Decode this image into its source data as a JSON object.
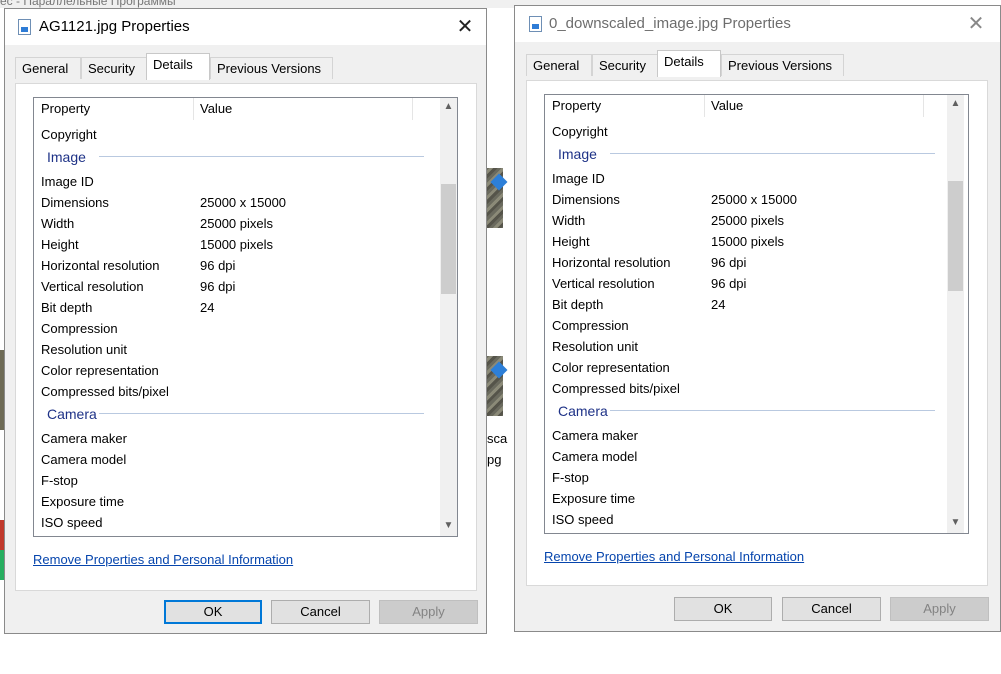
{
  "background": {
    "window_title_fragment": "ес - Параллельные Программы",
    "file_label_1": "sca",
    "file_label_2": "pg"
  },
  "dialogs": [
    {
      "title": "AG1121.jpg Properties",
      "tabs": [
        "General",
        "Security",
        "Details",
        "Previous Versions"
      ],
      "active_tab": "Details",
      "columns": {
        "property": "Property",
        "value": "Value"
      },
      "rows": [
        {
          "type": "prop",
          "p": "Copyright",
          "v": ""
        },
        {
          "type": "group",
          "p": "Image"
        },
        {
          "type": "prop",
          "p": "Image ID",
          "v": ""
        },
        {
          "type": "prop",
          "p": "Dimensions",
          "v": "25000 x 15000"
        },
        {
          "type": "prop",
          "p": "Width",
          "v": "25000 pixels"
        },
        {
          "type": "prop",
          "p": "Height",
          "v": "15000 pixels"
        },
        {
          "type": "prop",
          "p": "Horizontal resolution",
          "v": "96 dpi"
        },
        {
          "type": "prop",
          "p": "Vertical resolution",
          "v": "96 dpi"
        },
        {
          "type": "prop",
          "p": "Bit depth",
          "v": "24"
        },
        {
          "type": "prop",
          "p": "Compression",
          "v": ""
        },
        {
          "type": "prop",
          "p": "Resolution unit",
          "v": ""
        },
        {
          "type": "prop",
          "p": "Color representation",
          "v": ""
        },
        {
          "type": "prop",
          "p": "Compressed bits/pixel",
          "v": ""
        },
        {
          "type": "group",
          "p": "Camera"
        },
        {
          "type": "prop",
          "p": "Camera maker",
          "v": ""
        },
        {
          "type": "prop",
          "p": "Camera model",
          "v": ""
        },
        {
          "type": "prop",
          "p": "F-stop",
          "v": ""
        },
        {
          "type": "prop",
          "p": "Exposure time",
          "v": ""
        },
        {
          "type": "prop",
          "p": "ISO speed",
          "v": ""
        }
      ],
      "remove_link": "Remove Properties and Personal Information",
      "buttons": {
        "ok": "OK",
        "cancel": "Cancel",
        "apply": "Apply"
      }
    },
    {
      "title": "0_downscaled_image.jpg Properties",
      "tabs": [
        "General",
        "Security",
        "Details",
        "Previous Versions"
      ],
      "active_tab": "Details",
      "columns": {
        "property": "Property",
        "value": "Value"
      },
      "rows": [
        {
          "type": "prop",
          "p": "Copyright",
          "v": ""
        },
        {
          "type": "group",
          "p": "Image"
        },
        {
          "type": "prop",
          "p": "Image ID",
          "v": ""
        },
        {
          "type": "prop",
          "p": "Dimensions",
          "v": "25000 x 15000"
        },
        {
          "type": "prop",
          "p": "Width",
          "v": "25000 pixels"
        },
        {
          "type": "prop",
          "p": "Height",
          "v": "15000 pixels"
        },
        {
          "type": "prop",
          "p": "Horizontal resolution",
          "v": "96 dpi"
        },
        {
          "type": "prop",
          "p": "Vertical resolution",
          "v": "96 dpi"
        },
        {
          "type": "prop",
          "p": "Bit depth",
          "v": "24"
        },
        {
          "type": "prop",
          "p": "Compression",
          "v": ""
        },
        {
          "type": "prop",
          "p": "Resolution unit",
          "v": ""
        },
        {
          "type": "prop",
          "p": "Color representation",
          "v": ""
        },
        {
          "type": "prop",
          "p": "Compressed bits/pixel",
          "v": ""
        },
        {
          "type": "group",
          "p": "Camera"
        },
        {
          "type": "prop",
          "p": "Camera maker",
          "v": ""
        },
        {
          "type": "prop",
          "p": "Camera model",
          "v": ""
        },
        {
          "type": "prop",
          "p": "F-stop",
          "v": ""
        },
        {
          "type": "prop",
          "p": "Exposure time",
          "v": ""
        },
        {
          "type": "prop",
          "p": "ISO speed",
          "v": ""
        }
      ],
      "remove_link": "Remove Properties and Personal Information",
      "buttons": {
        "ok": "OK",
        "cancel": "Cancel",
        "apply": "Apply"
      }
    }
  ],
  "colors": {
    "link": "#0645ad",
    "group_header": "#1e3287",
    "default_button_border": "#0078d7"
  }
}
